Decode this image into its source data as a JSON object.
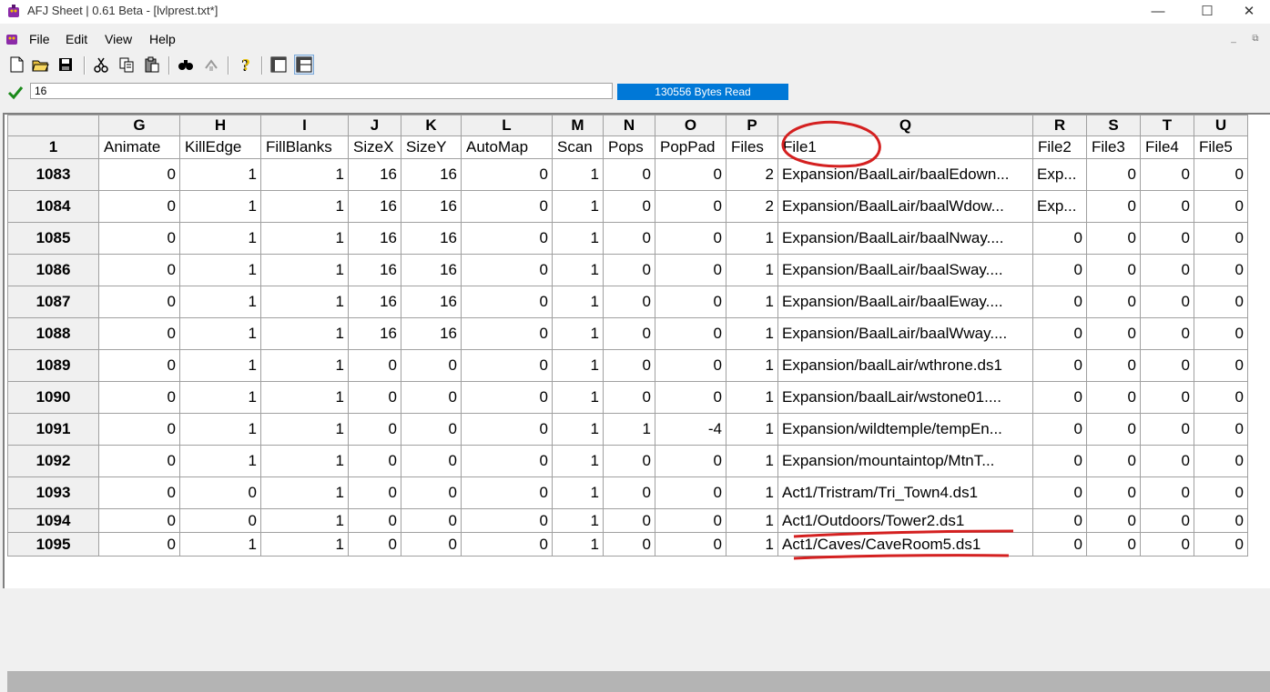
{
  "window": {
    "title": "AFJ Sheet | 0.61 Beta - [lvlprest.txt*]"
  },
  "menu": [
    "File",
    "Edit",
    "View",
    "Help"
  ],
  "toolbar": {
    "icons": [
      "new-icon",
      "open-icon",
      "save-icon",
      "cut-icon",
      "copy-icon",
      "paste-icon",
      "find-icon",
      "replace-icon",
      "help-icon",
      "view-normal-icon",
      "view-split-icon"
    ]
  },
  "formula": {
    "value": "16"
  },
  "status": {
    "text": "130556 Bytes Read"
  },
  "grid": {
    "corner": "1",
    "columns": [
      {
        "letter": "G",
        "name": "Animate"
      },
      {
        "letter": "H",
        "name": "KillEdge"
      },
      {
        "letter": "I",
        "name": "FillBlanks"
      },
      {
        "letter": "J",
        "name": "SizeX"
      },
      {
        "letter": "K",
        "name": "SizeY"
      },
      {
        "letter": "L",
        "name": "AutoMap"
      },
      {
        "letter": "M",
        "name": "Scan"
      },
      {
        "letter": "N",
        "name": "Pops"
      },
      {
        "letter": "O",
        "name": "PopPad"
      },
      {
        "letter": "P",
        "name": "Files"
      },
      {
        "letter": "Q",
        "name": "File1"
      },
      {
        "letter": "R",
        "name": "File2"
      },
      {
        "letter": "S",
        "name": "File3"
      },
      {
        "letter": "T",
        "name": "File4"
      },
      {
        "letter": "U",
        "name": "File5"
      }
    ],
    "rows": [
      {
        "id": "1083",
        "cells": [
          "0",
          "1",
          "1",
          "16",
          "16",
          "0",
          "1",
          "0",
          "0",
          "2",
          "Expansion/BaalLair/baalEdown...",
          "Exp...",
          "0",
          "0",
          "0"
        ]
      },
      {
        "id": "1084",
        "cells": [
          "0",
          "1",
          "1",
          "16",
          "16",
          "0",
          "1",
          "0",
          "0",
          "2",
          "Expansion/BaalLair/baalWdow...",
          "Exp...",
          "0",
          "0",
          "0"
        ]
      },
      {
        "id": "1085",
        "cells": [
          "0",
          "1",
          "1",
          "16",
          "16",
          "0",
          "1",
          "0",
          "0",
          "1",
          "Expansion/BaalLair/baalNway....",
          "0",
          "0",
          "0",
          "0"
        ]
      },
      {
        "id": "1086",
        "cells": [
          "0",
          "1",
          "1",
          "16",
          "16",
          "0",
          "1",
          "0",
          "0",
          "1",
          "Expansion/BaalLair/baalSway....",
          "0",
          "0",
          "0",
          "0"
        ]
      },
      {
        "id": "1087",
        "cells": [
          "0",
          "1",
          "1",
          "16",
          "16",
          "0",
          "1",
          "0",
          "0",
          "1",
          "Expansion/BaalLair/baalEway....",
          "0",
          "0",
          "0",
          "0"
        ]
      },
      {
        "id": "1088",
        "cells": [
          "0",
          "1",
          "1",
          "16",
          "16",
          "0",
          "1",
          "0",
          "0",
          "1",
          "Expansion/BaalLair/baalWway....",
          "0",
          "0",
          "0",
          "0"
        ]
      },
      {
        "id": "1089",
        "cells": [
          "0",
          "1",
          "1",
          "0",
          "0",
          "0",
          "1",
          "0",
          "0",
          "1",
          "Expansion/baalLair/wthrone.ds1",
          "0",
          "0",
          "0",
          "0"
        ]
      },
      {
        "id": "1090",
        "cells": [
          "0",
          "1",
          "1",
          "0",
          "0",
          "0",
          "1",
          "0",
          "0",
          "1",
          "Expansion/baalLair/wstone01....",
          "0",
          "0",
          "0",
          "0"
        ]
      },
      {
        "id": "1091",
        "cells": [
          "0",
          "1",
          "1",
          "0",
          "0",
          "0",
          "1",
          "1",
          "-4",
          "1",
          "Expansion/wildtemple/tempEn...",
          "0",
          "0",
          "0",
          "0"
        ]
      },
      {
        "id": "1092",
        "cells": [
          "0",
          "1",
          "1",
          "0",
          "0",
          "0",
          "1",
          "0",
          "0",
          "1",
          "Expansion/mountaintop/MtnT...",
          "0",
          "0",
          "0",
          "0"
        ]
      },
      {
        "id": "1093",
        "cells": [
          "0",
          "0",
          "1",
          "0",
          "0",
          "0",
          "1",
          "0",
          "0",
          "1",
          "Act1/Tristram/Tri_Town4.ds1",
          "0",
          "0",
          "0",
          "0"
        ]
      },
      {
        "id": "1094",
        "cells": [
          "0",
          "0",
          "1",
          "0",
          "0",
          "0",
          "1",
          "0",
          "0",
          "1",
          "Act1/Outdoors/Tower2.ds1",
          "0",
          "0",
          "0",
          "0"
        ]
      },
      {
        "id": "1095",
        "cells": [
          "0",
          "1",
          "1",
          "0",
          "0",
          "0",
          "1",
          "0",
          "0",
          "1",
          "Act1/Caves/CaveRoom5.ds1",
          "0",
          "0",
          "0",
          "0"
        ]
      }
    ]
  },
  "colors": {
    "status_bg": "#0078d7",
    "annotation": "#d42020"
  }
}
